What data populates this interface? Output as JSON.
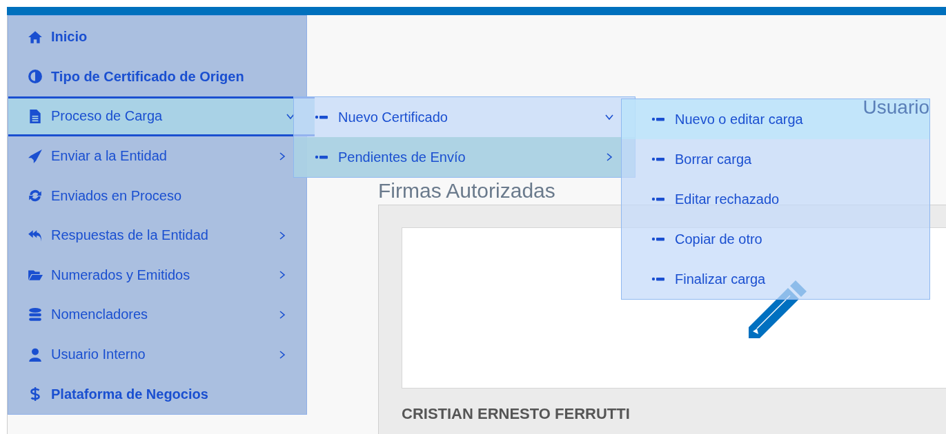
{
  "sidebar": {
    "items": [
      {
        "label": "Inicio",
        "kind": "link",
        "selected": false
      },
      {
        "label": "Tipo de Certificado de Origen",
        "kind": "link",
        "selected": false
      },
      {
        "label": "Proceso de Carga",
        "kind": "submenu",
        "selected": true,
        "expanded": true
      },
      {
        "label": "Enviar a la Entidad",
        "kind": "submenu",
        "selected": false,
        "expanded": false
      },
      {
        "label": "Enviados en Proceso",
        "kind": "plain",
        "selected": false
      },
      {
        "label": "Respuestas de la Entidad",
        "kind": "submenu",
        "selected": false,
        "expanded": false
      },
      {
        "label": "Numerados y Emitidos",
        "kind": "submenu",
        "selected": false,
        "expanded": false
      },
      {
        "label": "Nomencladores",
        "kind": "submenu",
        "selected": false,
        "expanded": false
      },
      {
        "label": "Usuario Interno",
        "kind": "submenu",
        "selected": false,
        "expanded": false
      },
      {
        "label": "Plataforma de Negocios",
        "kind": "link",
        "selected": false
      }
    ]
  },
  "submenu": {
    "items": [
      {
        "label": "Nuevo Certificado",
        "selected": false,
        "expanded": true
      },
      {
        "label": "Pendientes de Envío",
        "selected": true,
        "expanded": false
      }
    ]
  },
  "flyout": {
    "items": [
      {
        "label": "Nuevo o editar carga",
        "selected": true
      },
      {
        "label": "Borrar carga",
        "selected": false
      },
      {
        "label": "Editar rechazado",
        "selected": false
      },
      {
        "label": "Copiar de otro",
        "selected": false
      },
      {
        "label": "Finalizar carga",
        "selected": false
      }
    ]
  },
  "header": {
    "user_label": "Usuario"
  },
  "section_title": "Firmas Autorizadas",
  "signature_card": {
    "name": "CRISTIAN ERNESTO FERRUTTI"
  }
}
